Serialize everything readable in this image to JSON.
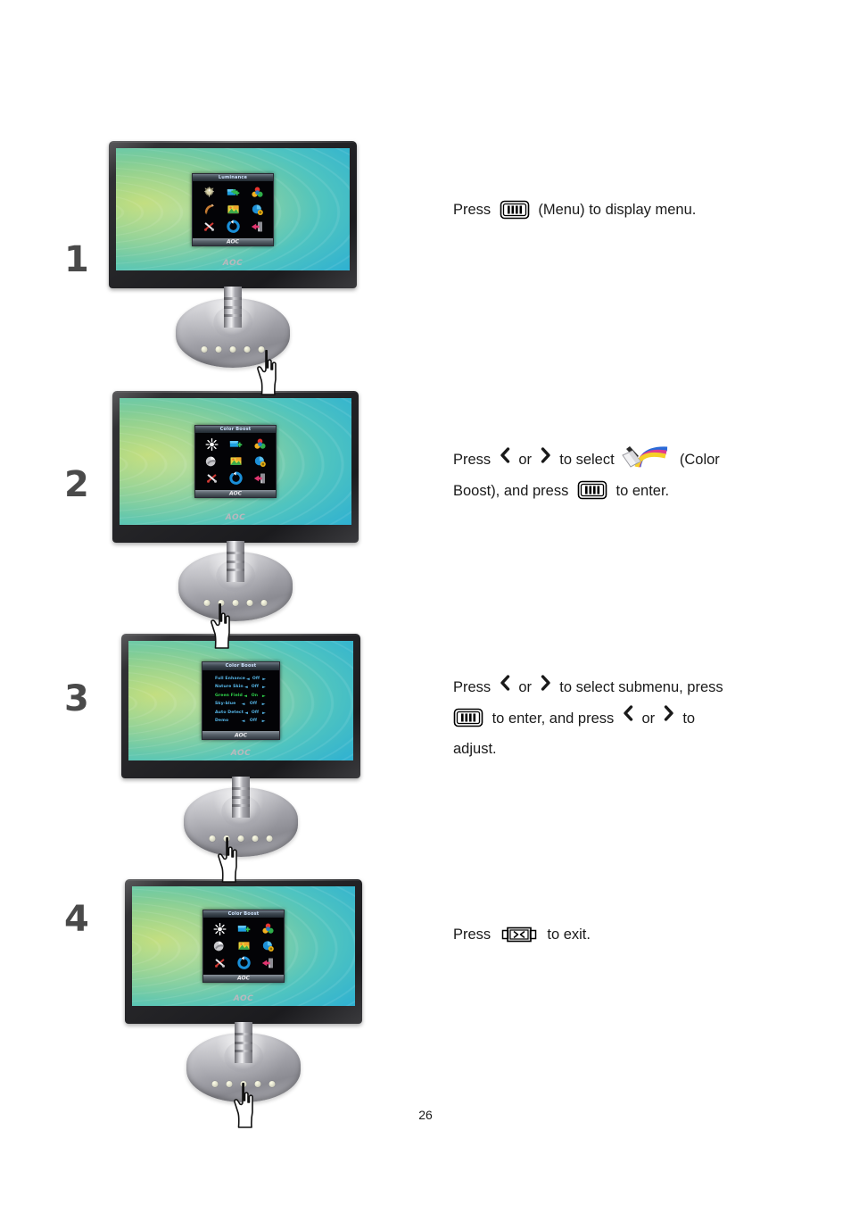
{
  "document": {
    "page_number": "26"
  },
  "steps": [
    {
      "number": "1",
      "osd": {
        "title": "Luminance",
        "brand": "AOC",
        "type": "icon-grid"
      },
      "instruction": {
        "lines": [
          {
            "parts": [
              "Press ",
              "{menu-icon}",
              " (Menu) to display menu."
            ]
          }
        ],
        "text_before": "Press",
        "text_after": "(Menu) to display menu."
      }
    },
    {
      "number": "2",
      "osd": {
        "title": "Color Boost",
        "brand": "AOC",
        "type": "icon-grid"
      },
      "instruction": {
        "line1_a": "Press",
        "line1_or": "or",
        "line1_b": "to select",
        "line1_c": "(Color",
        "line2_a": "Boost), and press",
        "line2_b": "to enter."
      }
    },
    {
      "number": "3",
      "osd": {
        "title": "Color Boost",
        "brand": "AOC",
        "type": "submenu",
        "rows": [
          {
            "label": "Full Enhance",
            "value": "Off",
            "selected": false
          },
          {
            "label": "Nature Skin",
            "value": "Off",
            "selected": false
          },
          {
            "label": "Green Field",
            "value": "On",
            "selected": true
          },
          {
            "label": "Sky-blue",
            "value": "Off",
            "selected": false
          },
          {
            "label": "Auto Detect",
            "value": "Off",
            "selected": false
          },
          {
            "label": "Demo",
            "value": "Off",
            "selected": false
          }
        ],
        "arrow_left": "◄",
        "arrow_right": "►"
      },
      "instruction": {
        "line1_a": "Press",
        "line1_or": "or",
        "line1_b": "to select submenu, press",
        "line2_a": "to enter, and press",
        "line2_or": "or",
        "line2_b": "to",
        "line3": "adjust."
      }
    },
    {
      "number": "4",
      "osd": {
        "title": "Color Boost",
        "brand": "AOC",
        "type": "icon-grid"
      },
      "instruction": {
        "text_before": "Press",
        "text_after": "to exit."
      }
    }
  ],
  "osd_icons": [
    {
      "name": "luminance-icon",
      "label": "Luminance"
    },
    {
      "name": "image-setup-icon",
      "label": "Image Setup"
    },
    {
      "name": "color-temperature-icon",
      "label": "Color Temperature"
    },
    {
      "name": "color-boost-icon",
      "label": "Color Boost"
    },
    {
      "name": "picture-boost-icon",
      "label": "Picture Boost"
    },
    {
      "name": "osd-setup-icon",
      "label": "OSD Setup"
    },
    {
      "name": "extra-icon",
      "label": "Extra"
    },
    {
      "name": "reset-icon",
      "label": "Reset"
    },
    {
      "name": "exit-icon",
      "label": "Exit"
    }
  ],
  "colors": {
    "bezel": "#242427",
    "screen_green": "#b9d96a",
    "screen_blue": "#1f96c9",
    "osd_bg": "#030306",
    "osd_text": "#56b6e8",
    "osd_selected": "#2fd34a",
    "text": "#1a1a1a"
  }
}
